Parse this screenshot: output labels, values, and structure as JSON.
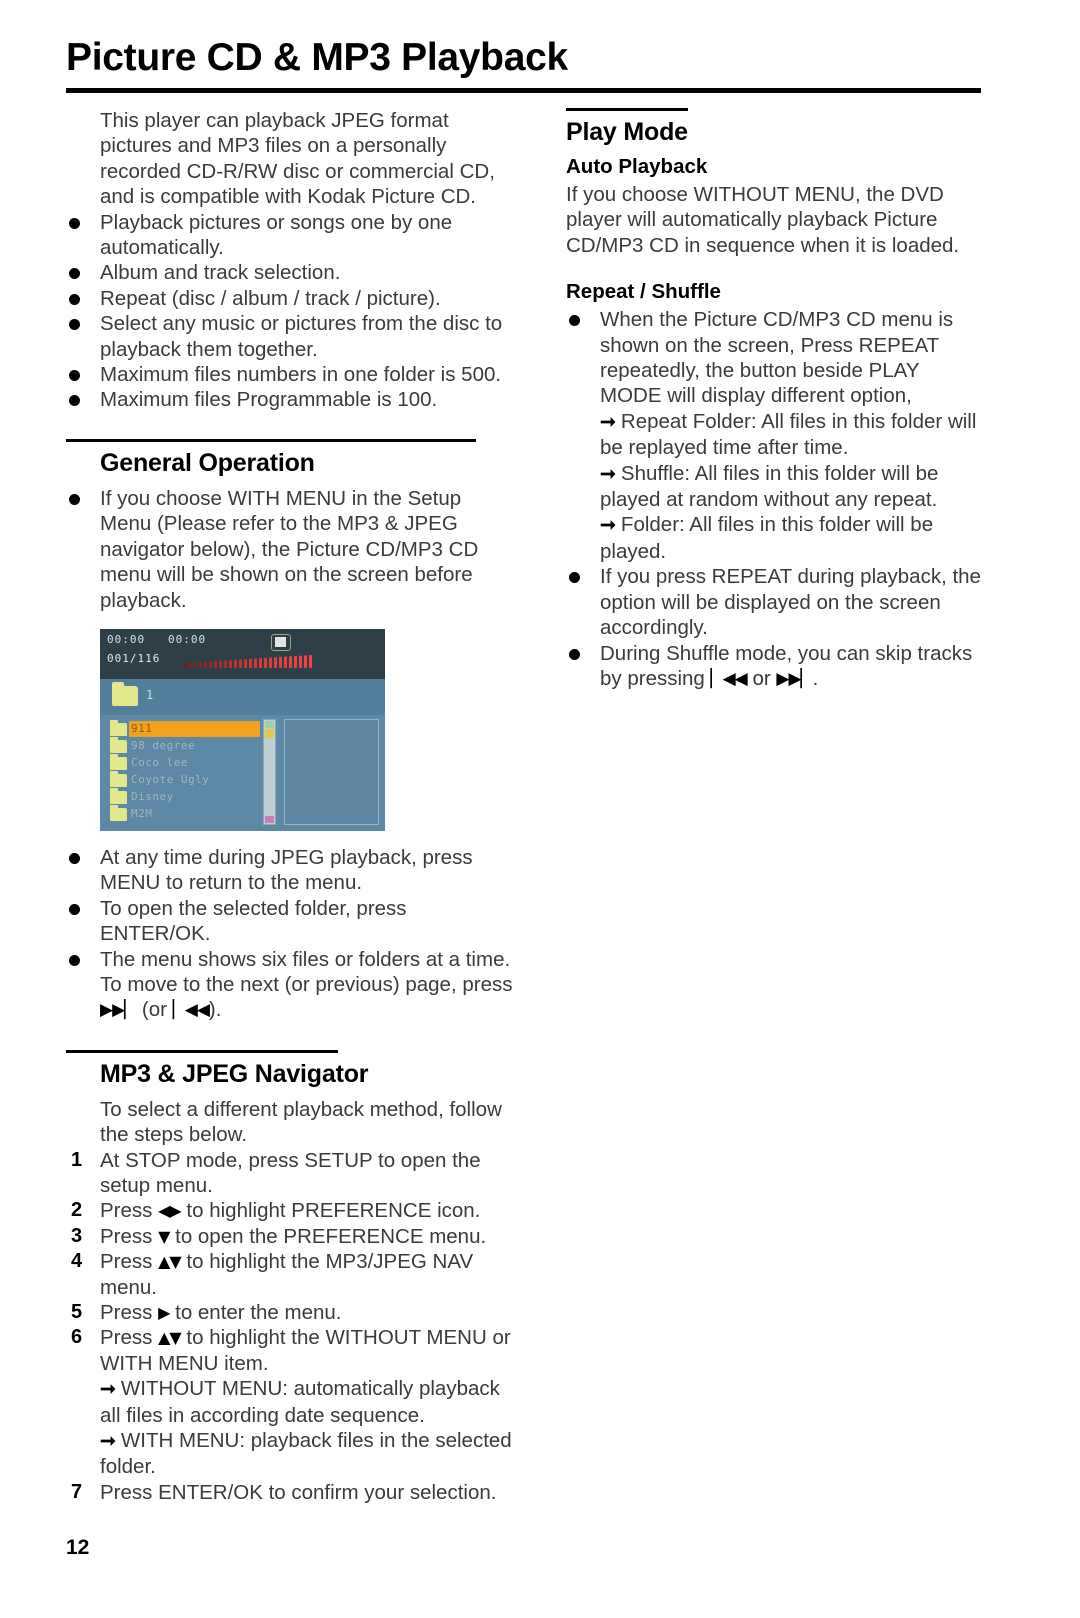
{
  "page": {
    "title": "Picture CD & MP3 Playback",
    "number": "12"
  },
  "left": {
    "intro": "This player can playback JPEG format pictures and MP3 files on a personally recorded CD-R/RW disc or commercial CD, and is compatible with Kodak Picture CD.",
    "features": [
      "Playback pictures or songs one by one automatically.",
      "Album and track selection.",
      "Repeat (disc / album / track / picture).",
      "Select any music or pictures from the disc to playback them together.",
      "Maximum files numbers in one folder is 500.",
      "Maximum files Programmable is 100."
    ],
    "general_operation": {
      "heading": "General Operation",
      "bullet": "If you choose WITH MENU in the Setup Menu (Please refer to the MP3 & JPEG navigator below), the Picture CD/MP3 CD menu will be shown on the screen before playback.",
      "bullets_after": [
        "At any time during JPEG playback, press MENU to return to the menu.",
        "To open the selected folder, press ENTER/OK."
      ],
      "paging_bullet_pre": "The menu shows six files or folders at a time. To move to the next (or previous) page, press ",
      "paging_bullet_glyph_next": "▶▶▏",
      "paging_bullet_mid": " (or ",
      "paging_bullet_glyph_prev": "▏◀◀",
      "paging_bullet_post": ")."
    },
    "screenshot": {
      "time_elapsed": "00:00",
      "time_total": "00:00",
      "track_counter": "001/116",
      "root_label": "1",
      "stop_icon": "stop-icon",
      "items": [
        {
          "name": "911",
          "selected": true
        },
        {
          "name": "98 degree",
          "selected": false
        },
        {
          "name": "Coco lee",
          "selected": false
        },
        {
          "name": "Coyote Ugly",
          "selected": false
        },
        {
          "name": "Disney",
          "selected": false
        },
        {
          "name": "M2M",
          "selected": false
        }
      ]
    },
    "navigator": {
      "heading": "MP3 & JPEG Navigator",
      "intro": "To select a different playback method, follow the steps below.",
      "steps": [
        {
          "num": "1",
          "pre": "At STOP mode, press SETUP to open the setup menu.",
          "glyph": "",
          "post": ""
        },
        {
          "num": "2",
          "pre": "Press ",
          "glyph": "◀▶",
          "post": " to highlight PREFERENCE icon."
        },
        {
          "num": "3",
          "pre": "Press ",
          "glyph": "▼",
          "post": " to open the PREFERENCE menu."
        },
        {
          "num": "4",
          "pre": "Press ",
          "glyph": "▲▼",
          "post": " to highlight the MP3/JPEG NAV menu."
        },
        {
          "num": "5",
          "pre": "Press ",
          "glyph": "▶",
          "post": " to enter the menu."
        },
        {
          "num": "6",
          "pre": "Press ",
          "glyph": "▲▼",
          "post": " to highlight the WITHOUT MENU or WITH MENU item."
        }
      ],
      "sub_arrows": [
        "WITHOUT MENU: automatically playback all files in according date sequence.",
        "WITH MENU: playback files in the selected folder."
      ],
      "final_step": {
        "num": "7",
        "text": "Press ENTER/OK to confirm your selection."
      }
    }
  },
  "right": {
    "play_mode": {
      "heading": "Play Mode",
      "auto_playback": {
        "subheading": "Auto Playback",
        "text": "If you choose WITHOUT MENU, the DVD player will automatically playback Picture CD/MP3 CD in sequence when it is loaded."
      },
      "repeat_shuffle": {
        "subheading": "Repeat / Shuffle",
        "bullet1": "When the Picture CD/MP3 CD menu is shown on the screen, Press REPEAT repeatedly, the button beside PLAY MODE will display different option,",
        "arrows": [
          "Repeat Folder: All files in this folder will be replayed time after time.",
          "Shuffle: All files in this folder will be played at random without any repeat.",
          "Folder: All files in this folder will be played."
        ],
        "bullet2": "If you press REPEAT during playback, the option will be displayed on the screen accordingly.",
        "bullet3_pre": "During Shuffle mode, you can skip tracks by pressing ",
        "bullet3_glyph_prev": "▏◀◀",
        "bullet3_mid": " or ",
        "bullet3_glyph_next": "▶▶▏",
        "bullet3_post": "."
      }
    }
  }
}
